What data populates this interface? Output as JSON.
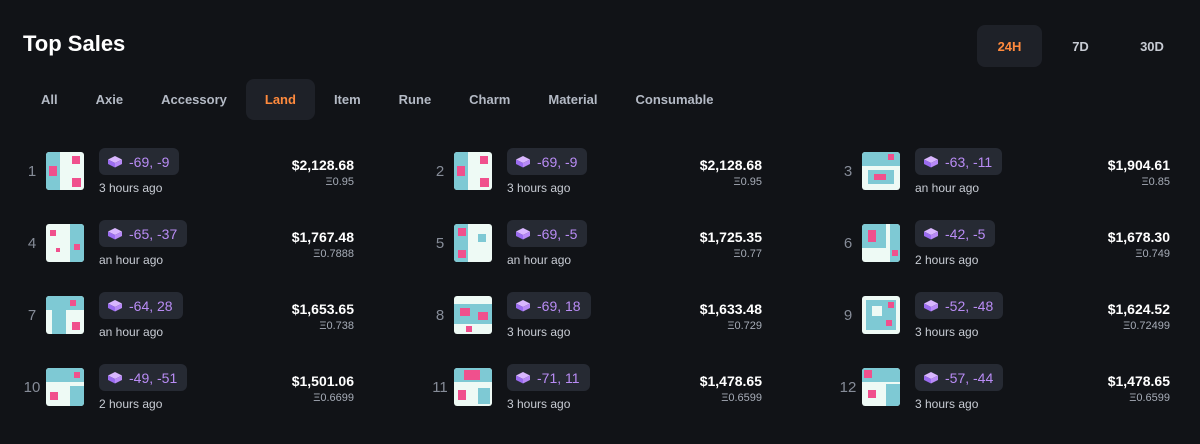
{
  "header": {
    "title": "Top Sales"
  },
  "periods": [
    {
      "label": "24H",
      "active": true
    },
    {
      "label": "7D",
      "active": false
    },
    {
      "label": "30D",
      "active": false
    }
  ],
  "tabs": [
    {
      "label": "All",
      "active": false
    },
    {
      "label": "Axie",
      "active": false
    },
    {
      "label": "Accessory",
      "active": false
    },
    {
      "label": "Land",
      "active": true
    },
    {
      "label": "Item",
      "active": false
    },
    {
      "label": "Rune",
      "active": false
    },
    {
      "label": "Charm",
      "active": false
    },
    {
      "label": "Material",
      "active": false
    },
    {
      "label": "Consumable",
      "active": false
    }
  ],
  "colors": {
    "accent": "#ff8a3d",
    "coord_text": "#b98cf5",
    "land_bg": "#eefaf5",
    "land_teal": "#7ec9d4",
    "land_pink": "#f0508d"
  },
  "sales": [
    {
      "rank": "1",
      "coords": "-69, -9",
      "ago": "3 hours ago",
      "usd": "$2,128.68",
      "eth": "Ξ0.95"
    },
    {
      "rank": "2",
      "coords": "-69, -9",
      "ago": "3 hours ago",
      "usd": "$2,128.68",
      "eth": "Ξ0.95"
    },
    {
      "rank": "3",
      "coords": "-63, -11",
      "ago": "an hour ago",
      "usd": "$1,904.61",
      "eth": "Ξ0.85"
    },
    {
      "rank": "4",
      "coords": "-65, -37",
      "ago": "an hour ago",
      "usd": "$1,767.48",
      "eth": "Ξ0.7888"
    },
    {
      "rank": "5",
      "coords": "-69, -5",
      "ago": "an hour ago",
      "usd": "$1,725.35",
      "eth": "Ξ0.77"
    },
    {
      "rank": "6",
      "coords": "-42, -5",
      "ago": "2 hours ago",
      "usd": "$1,678.30",
      "eth": "Ξ0.749"
    },
    {
      "rank": "7",
      "coords": "-64, 28",
      "ago": "an hour ago",
      "usd": "$1,653.65",
      "eth": "Ξ0.738"
    },
    {
      "rank": "8",
      "coords": "-69, 18",
      "ago": "3 hours ago",
      "usd": "$1,633.48",
      "eth": "Ξ0.729"
    },
    {
      "rank": "9",
      "coords": "-52, -48",
      "ago": "3 hours ago",
      "usd": "$1,624.52",
      "eth": "Ξ0.72499"
    },
    {
      "rank": "10",
      "coords": "-49, -51",
      "ago": "2 hours ago",
      "usd": "$1,501.06",
      "eth": "Ξ0.6699"
    },
    {
      "rank": "11",
      "coords": "-71, 11",
      "ago": "3 hours ago",
      "usd": "$1,478.65",
      "eth": "Ξ0.6599"
    },
    {
      "rank": "12",
      "coords": "-57, -44",
      "ago": "3 hours ago",
      "usd": "$1,478.65",
      "eth": "Ξ0.6599"
    }
  ]
}
